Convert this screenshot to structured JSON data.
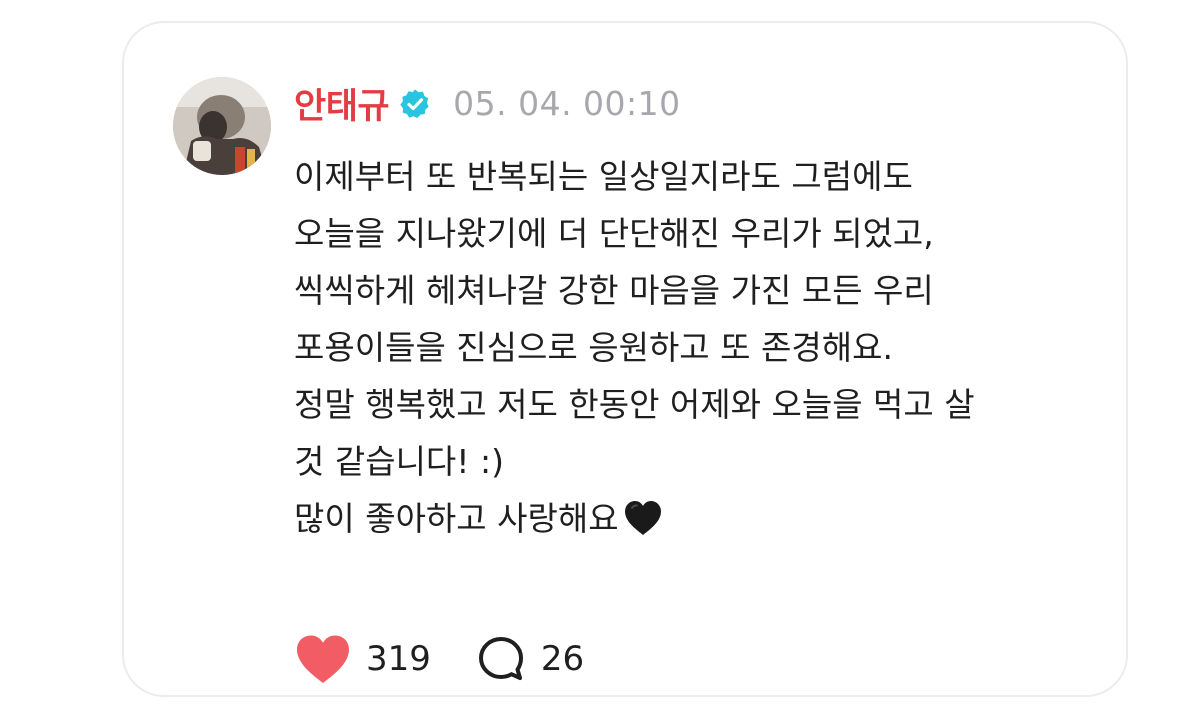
{
  "post": {
    "author": {
      "name": "안태규",
      "verified": true
    },
    "timestamp": "05. 04. 00:10",
    "body_lines": [
      "이제부터 또 반복되는 일상일지라도 그럼에도",
      "오늘을 지나왔기에 더 단단해진 우리가 되었고,",
      "씩씩하게 헤쳐나갈 강한 마음을 가진 모든 우리",
      "포용이들을 진심으로 응원하고 또 존경해요.",
      "정말 행복했고 저도 한동안 어제와 오늘을 먹고 살",
      "것 같습니다! :)",
      "많이 좋아하고 사랑해요"
    ],
    "trailing_emoji": "black-heart-icon",
    "likes": "319",
    "comments": "26"
  },
  "colors": {
    "author_name": "#e43c43",
    "verified_badge": "#29c4e0",
    "like_heart": "#f25c64",
    "timestamp": "#a7a7ad",
    "card_border": "#ececef"
  },
  "icons": {
    "verified": "verified-badge-icon",
    "more": "more-vertical-icon",
    "like": "heart-icon",
    "comment": "comment-bubble-icon"
  }
}
